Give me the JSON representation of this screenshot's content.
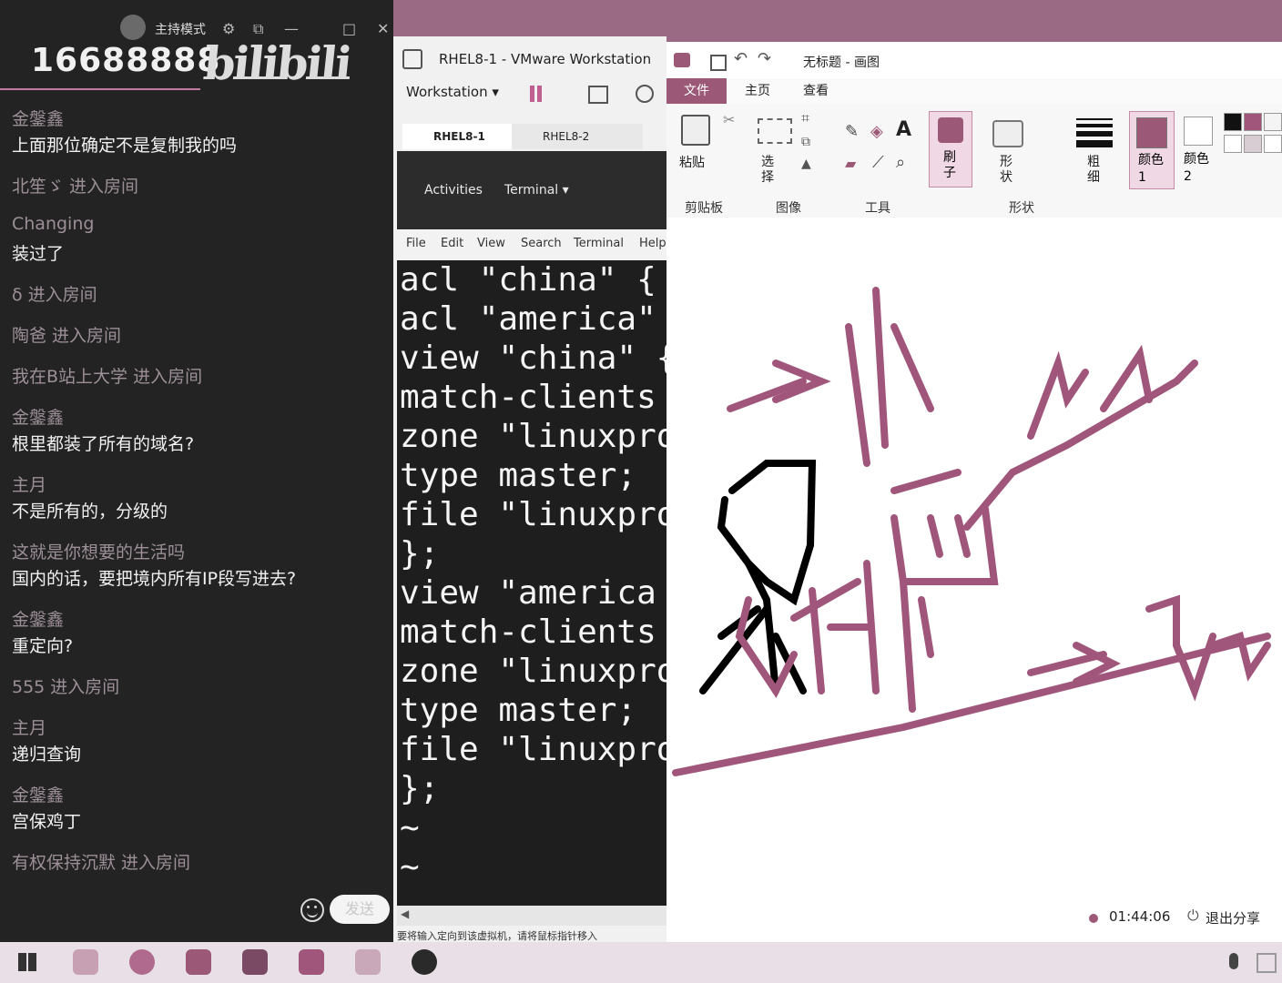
{
  "chat": {
    "host_mode": "主持模式",
    "room_id": "16688888",
    "logo": "bilibili",
    "messages": [
      {
        "type": "msg",
        "name": "金鎜鑫",
        "text": "上面那位确定不是复制我的吗"
      },
      {
        "type": "enter",
        "text": "北笙ゞ 进入房间"
      },
      {
        "type": "msg",
        "name": "Changing",
        "text": "装过了"
      },
      {
        "type": "enter",
        "text": "δ 进入房间"
      },
      {
        "type": "enter",
        "text": "陶爸 进入房间"
      },
      {
        "type": "enter",
        "text": "我在B站上大学 进入房间"
      },
      {
        "type": "msg",
        "name": "金鎜鑫",
        "text": "根里都装了所有的域名?"
      },
      {
        "type": "msg",
        "name": "主月",
        "text": "不是所有的，分级的"
      },
      {
        "type": "msg",
        "name": "这就是你想要的生活吗",
        "text": "国内的话，要把境内所有IP段写进去?"
      },
      {
        "type": "msg",
        "name": "金鎜鑫",
        "text": "重定向?"
      },
      {
        "type": "enter",
        "text": "555 进入房间"
      },
      {
        "type": "msg",
        "name": "主月",
        "text": "递归查询"
      },
      {
        "type": "msg",
        "name": "金鎜鑫",
        "text": "宫保鸡丁"
      },
      {
        "type": "enter",
        "text": "有权保持沉默 进入房间"
      }
    ],
    "send_label": "发送"
  },
  "vmware": {
    "title": "RHEL8-1 - VMware Workstation",
    "menu_label": "Workstation",
    "tabs": [
      "RHEL8-1",
      "RHEL8-2"
    ],
    "activities": "Activities",
    "terminal_menu": "Terminal",
    "term_menu_items": [
      "File",
      "Edit",
      "View",
      "Search",
      "Terminal",
      "Help"
    ],
    "terminal_lines": [
      "acl \"china\" {",
      "acl \"america\"",
      "view \"china\" {",
      "match-clients",
      "zone \"linuxpro",
      "type master;",
      "file \"linuxpro",
      "};",
      "view \"america",
      "match-clients",
      "zone \"linuxpro",
      "type master;",
      "file \"linuxpro",
      "};",
      "~",
      "~"
    ],
    "status_text": "要将输入定向到该虚拟机，请将鼠标指针移入"
  },
  "paint": {
    "title": "无标题 - 画图",
    "tabs": [
      "文件",
      "主页",
      "查看"
    ],
    "tools": {
      "paste": "粘贴",
      "select": "选择",
      "brush": "刷子",
      "shapes": "形状",
      "size": "粗细",
      "color1": "颜色 1",
      "color2": "颜色 2"
    },
    "groups": [
      "剪贴板",
      "图像",
      "工具",
      "形状"
    ],
    "timer": "01:44:06",
    "exit_share": "退出分享",
    "ink_color": "#a0557a",
    "palette": [
      "#111111",
      "#a0557a",
      "#f4f4f4",
      "#ffffff",
      "#d8cdd3",
      "#ffffff"
    ]
  }
}
